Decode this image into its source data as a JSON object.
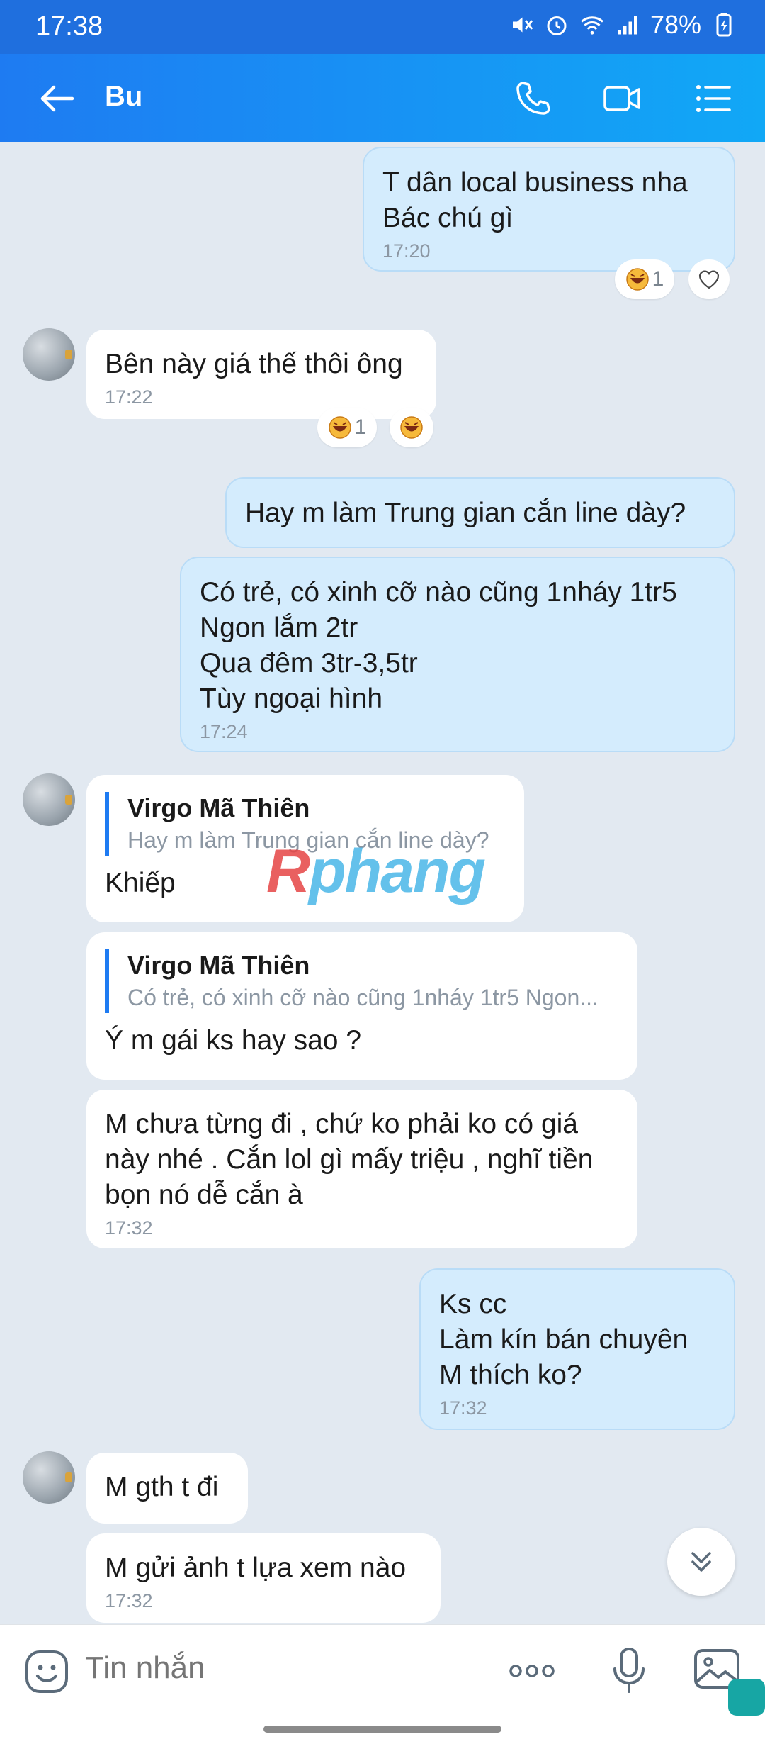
{
  "status_bar": {
    "time": "17:38",
    "battery": "78%"
  },
  "header": {
    "back_icon": "arrow-left-icon",
    "title": "Bu",
    "icons": [
      "phone-icon",
      "video-call-icon",
      "menu-list-icon"
    ]
  },
  "messages": [
    {
      "dir": "out",
      "lines": [
        "T dân local business nha",
        "Bác chú gì"
      ],
      "time": "17:20",
      "reactions": [
        {
          "count": "1"
        }
      ]
    },
    {
      "dir": "in",
      "lines": [
        "Bên này giá thế thôi ông"
      ],
      "time": "17:22",
      "reactions": [
        {
          "count": "1"
        }
      ]
    },
    {
      "dir": "out",
      "lines": [
        "Hay m làm Trung gian cắn line dày?"
      ]
    },
    {
      "dir": "out",
      "lines": [
        "Có trẻ, có xinh cỡ nào cũng 1nháy 1tr5",
        "Ngon lắm 2tr",
        "Qua đêm 3tr-3,5tr",
        "Tùy ngoại hình"
      ],
      "time": "17:24"
    },
    {
      "dir": "in",
      "quote": {
        "name": "Virgo Mã Thiên",
        "text": "Hay m làm Trung gian cắn line dày?"
      },
      "lines": [
        "Khiếp"
      ]
    },
    {
      "dir": "in",
      "quote": {
        "name": "Virgo Mã Thiên",
        "text": "Có trẻ, có xinh cỡ nào cũng 1nháy 1tr5  Ngon..."
      },
      "lines": [
        "Ý m gái ks hay sao ?"
      ]
    },
    {
      "dir": "in",
      "lines": [
        "M chưa từng đi , chứ ko phải ko có giá",
        "này nhé . Cắn lol gì mấy triệu , nghĩ tiền",
        "bọn nó dễ cắn à"
      ],
      "time": "17:32"
    },
    {
      "dir": "out",
      "lines": [
        "Ks cc",
        "Làm kín bán chuyên",
        "M thích ko?"
      ],
      "time": "17:32"
    },
    {
      "dir": "in",
      "lines": [
        "M gth t đi"
      ]
    },
    {
      "dir": "in",
      "lines": [
        "M gửi ảnh t lựa xem nào"
      ],
      "time": "17:32"
    }
  ],
  "watermark": {
    "first": "R",
    "rest": "phang"
  },
  "input": {
    "placeholder": "Tin nhắn"
  },
  "colors": {
    "header_start": "#1e7bf2",
    "header_end": "#11a8f6",
    "outgoing_bubble": "#d4ecfd",
    "incoming_bubble": "#ffffff",
    "chat_bg": "#e2e9f1"
  }
}
